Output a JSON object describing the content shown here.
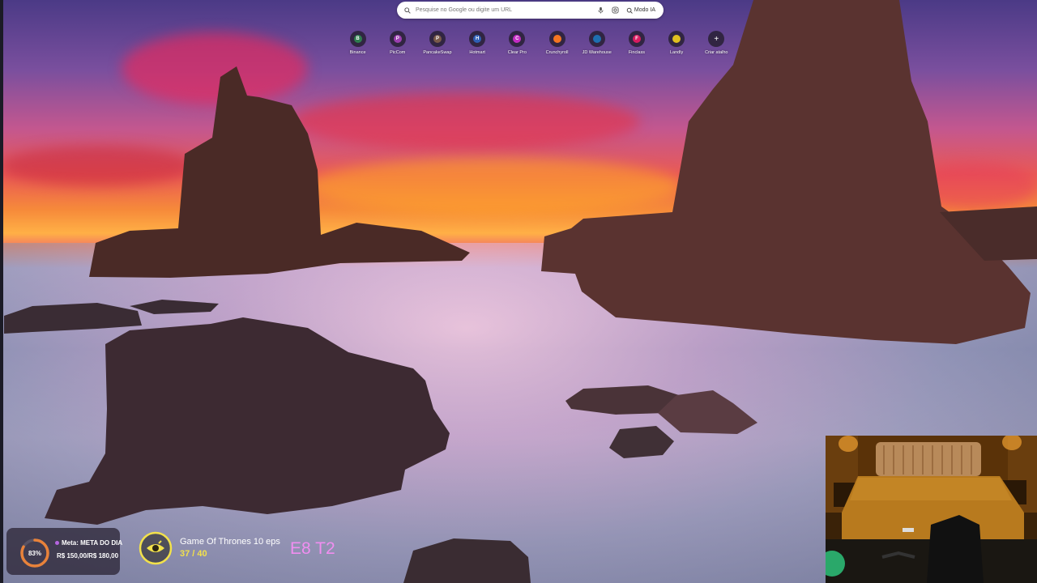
{
  "search": {
    "placeholder": "Pesquise no Google ou digite um URL",
    "ai_mode_label": "Modo IA"
  },
  "shortcuts": [
    {
      "label": "Binance",
      "letter": "B",
      "color": "#2e7d4f"
    },
    {
      "label": "PicCom",
      "letter": "P",
      "color": "#9c3fb0"
    },
    {
      "label": "PancakeSwap",
      "letter": "P",
      "color": "#7a5a4a"
    },
    {
      "label": "Hotmart",
      "letter": "H",
      "color": "#2f5fb5"
    },
    {
      "label": "Clear Pro",
      "letter": "C",
      "color": "#c42cc4"
    },
    {
      "label": "Crunchyroll",
      "letter": "",
      "color": "#f47521"
    },
    {
      "label": "JD Warehouse",
      "letter": "",
      "color": "#1e6fb0"
    },
    {
      "label": "Finclass",
      "letter": "F",
      "color": "#d81b60"
    },
    {
      "label": "Landly",
      "letter": "",
      "color": "#e0c020"
    },
    {
      "label": "Criar atalho",
      "letter": "+",
      "color": "transparent"
    }
  ],
  "goal": {
    "percent_label": "83%",
    "percent": 0.83,
    "title": "Meta: META DO DIA",
    "amount": "R$ 150,00/R$ 180,00",
    "ring_color": "#e8823a"
  },
  "series": {
    "title": "Game Of Thrones 10 eps",
    "progress": "37 / 40",
    "icon": "eye-icon",
    "accent": "#f2e14b"
  },
  "episode_tag": "E8 T2"
}
